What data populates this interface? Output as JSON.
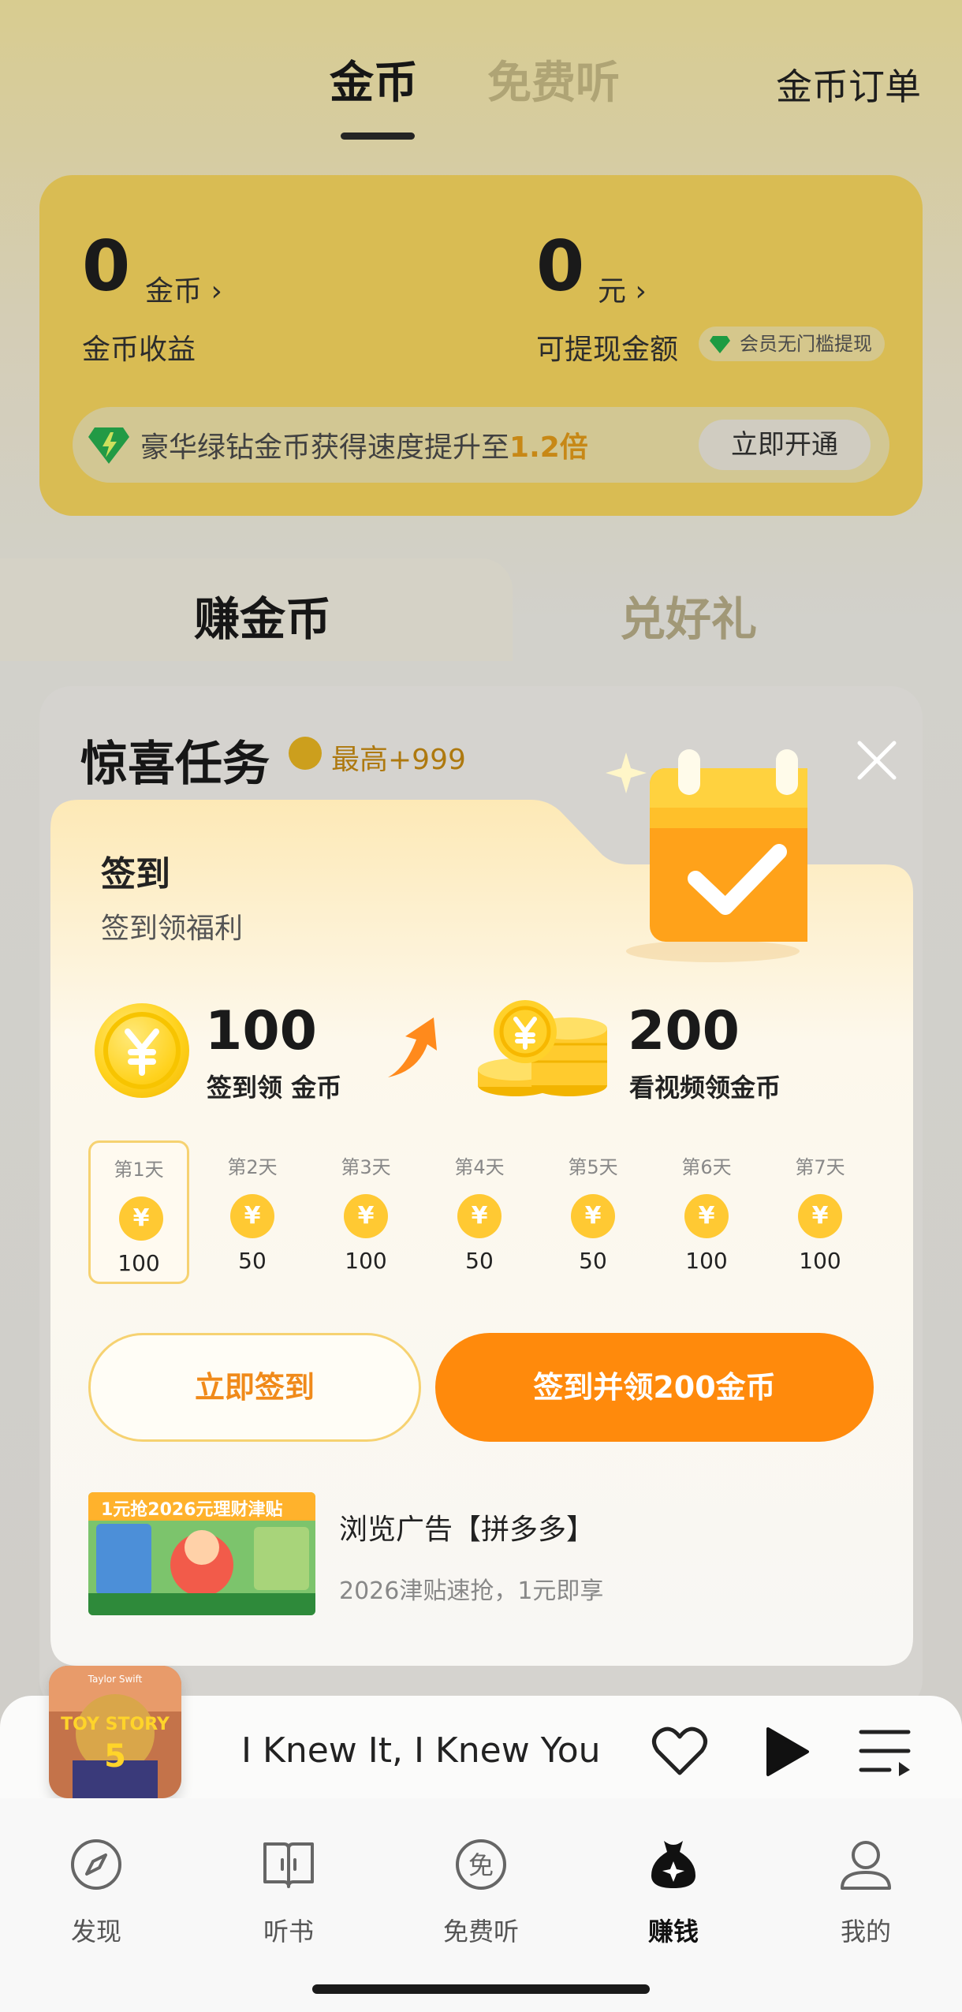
{
  "header": {
    "tabs": [
      {
        "label": "金币",
        "active": true
      },
      {
        "label": "免费听",
        "active": false
      }
    ],
    "orders_label": "金币订单"
  },
  "coin_card": {
    "coins_value": "0",
    "coins_unit": "金币",
    "coins_caption": "金币收益",
    "cash_value": "0",
    "cash_unit": "元",
    "cash_caption": "可提现金额",
    "vip_pill": "会员无门槛提现",
    "promo_text": "豪华绿钻金币获得速度提升至",
    "promo_highlight": "1.2倍",
    "promo_button": "立即开通"
  },
  "earn_tabs": [
    {
      "label": "赚金币",
      "active": true
    },
    {
      "label": "兑好礼",
      "active": false
    }
  ],
  "task_section": {
    "title": "惊喜任务",
    "max_reward": "最高+999"
  },
  "dialog": {
    "title": "签到",
    "subtitle": "签到领福利",
    "reward_basic": {
      "amount": "100",
      "label": "签到领 金币"
    },
    "reward_video": {
      "amount": "200",
      "label": "看视频领金币"
    },
    "days": [
      {
        "label": "第1天",
        "value": "100",
        "active": true
      },
      {
        "label": "第2天",
        "value": "50",
        "active": false
      },
      {
        "label": "第3天",
        "value": "100",
        "active": false
      },
      {
        "label": "第4天",
        "value": "50",
        "active": false
      },
      {
        "label": "第5天",
        "value": "50",
        "active": false
      },
      {
        "label": "第6天",
        "value": "100",
        "active": false
      },
      {
        "label": "第7天",
        "value": "100",
        "active": false
      }
    ],
    "btn_checkin": "立即签到",
    "btn_checkin_video": "签到并领200金币",
    "ad": {
      "image_caption": "1元抢2026元理财津贴",
      "title": "浏览广告【拼多多】",
      "desc": "2026津贴速抢，1元即享"
    }
  },
  "player": {
    "album_text_top": "Taylor Swift",
    "album_text_mid": "TOY STORY",
    "album_text_num": "5",
    "song_title": "I Knew It, I Knew You"
  },
  "tabbar": [
    {
      "label": "发现",
      "icon": "compass-icon",
      "active": false
    },
    {
      "label": "听书",
      "icon": "book-icon",
      "active": false
    },
    {
      "label": "免费听",
      "icon": "free-icon",
      "active": false
    },
    {
      "label": "赚钱",
      "icon": "money-bag-icon",
      "active": true
    },
    {
      "label": "我的",
      "icon": "profile-icon",
      "active": false
    }
  ],
  "colors": {
    "accent_orange": "#ff8a0c",
    "coin_yellow": "#ffc933",
    "card_yellow": "#f7d65f",
    "vip_green": "#22b14c"
  }
}
